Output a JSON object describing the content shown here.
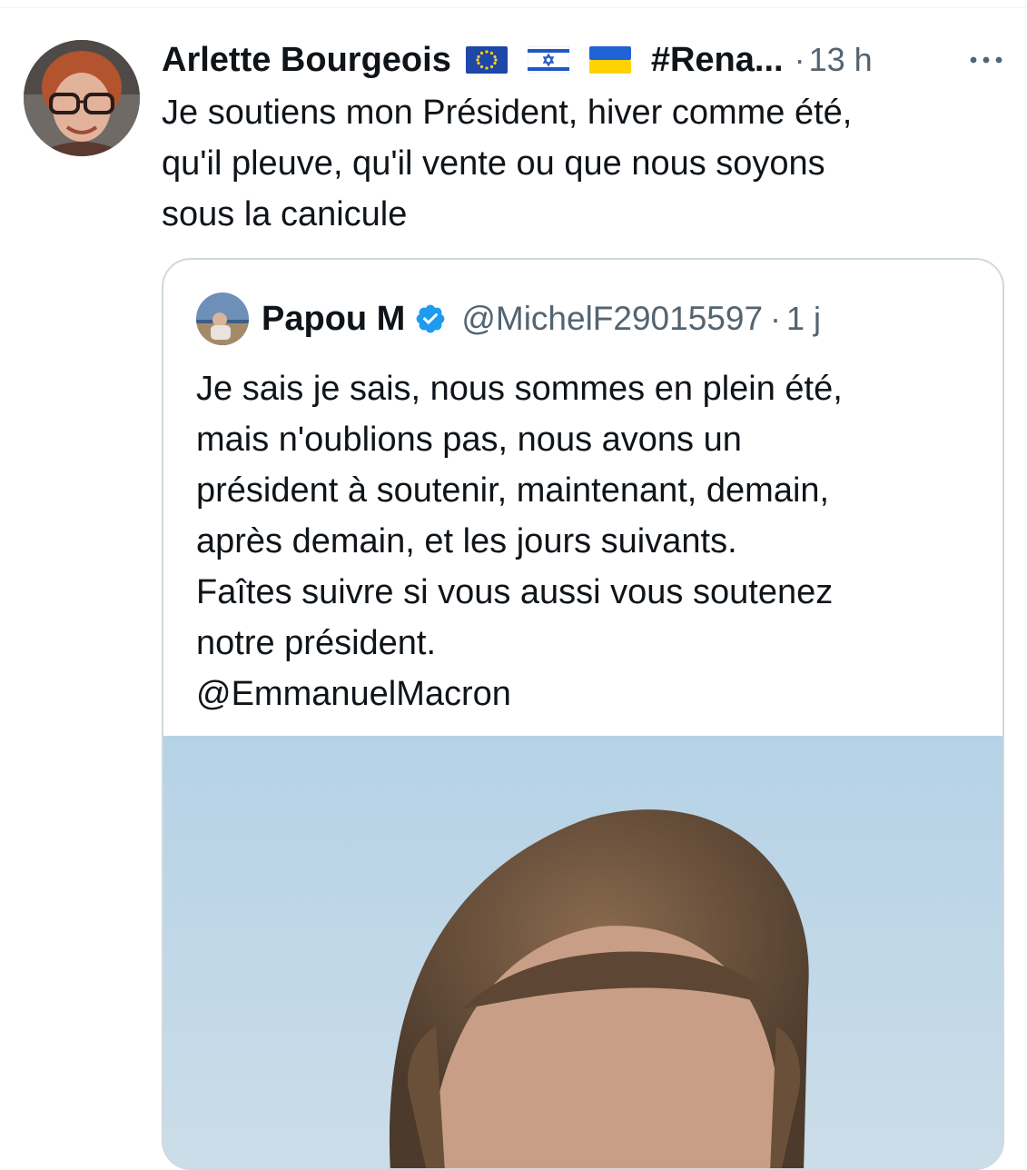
{
  "tweet": {
    "author_name": "Arlette Bourgeois",
    "hashtag": "#Rena...",
    "separator": "·",
    "time": "13 h",
    "more_icon": "more-horizontal-icon",
    "text_lines": [
      "Je soutiens mon Président, hiver comme été,",
      "qu'il pleuve, qu'il vente ou que nous soyons",
      "sous la canicule"
    ],
    "flags": [
      "eu-flag-icon",
      "israel-flag-icon",
      "ukraine-flag-icon"
    ]
  },
  "quote": {
    "author_name": "Papou M",
    "verified_icon": "verified-badge-icon",
    "handle": "@MichelF29015597",
    "separator": "·",
    "time": "1 j",
    "text_lines": [
      "Je sais je sais, nous sommes en plein été,",
      "mais n'oublions pas, nous avons un",
      "président à soutenir, maintenant, demain,",
      "après demain, et les jours suivants.",
      "Faîtes suivre si vous aussi vous soutenez",
      "notre président.",
      "@EmmanuelMacron"
    ]
  },
  "colors": {
    "text": "#0f1419",
    "secondary": "#536471",
    "border": "#cfd9de",
    "verified": "#1d9bf0"
  }
}
